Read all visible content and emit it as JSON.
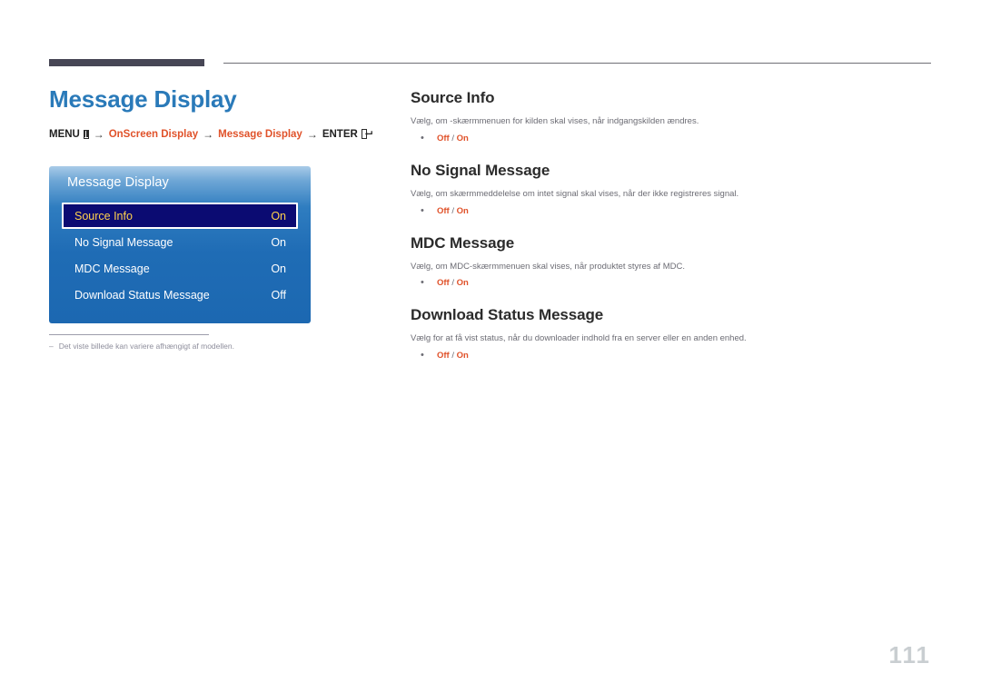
{
  "page": {
    "title": "Message Display",
    "number": "111"
  },
  "breadcrumb": {
    "menu_label": "MENU",
    "menu_icon": "menu-grid-icon",
    "arrow": "→",
    "step1": "OnScreen Display",
    "step2": "Message Display",
    "enter_label": "ENTER",
    "enter_icon": "enter-return-icon"
  },
  "osd_panel": {
    "title": "Message Display",
    "rows": [
      {
        "label": "Source Info",
        "value": "On",
        "selected": true
      },
      {
        "label": "No Signal Message",
        "value": "On",
        "selected": false
      },
      {
        "label": "MDC Message",
        "value": "On",
        "selected": false
      },
      {
        "label": "Download Status Message",
        "value": "Off",
        "selected": false
      }
    ]
  },
  "footnote": {
    "dash": "–",
    "text": "Det viste billede kan variere afhængigt af modellen."
  },
  "sections": [
    {
      "title": "Source Info",
      "desc": "Vælg, om -skærmmenuen for kilden skal vises, når indgangskilden ændres.",
      "bullet_dot": "•",
      "option_off": "Off",
      "option_sep": " / ",
      "option_on": "On"
    },
    {
      "title": "No Signal Message",
      "desc": "Vælg, om skærmmeddelelse om intet signal skal vises, når der ikke registreres signal.",
      "bullet_dot": "•",
      "option_off": "Off",
      "option_sep": " / ",
      "option_on": "On"
    },
    {
      "title": "MDC Message",
      "desc": "Vælg, om MDC-skærmmenuen skal vises, når produktet styres af MDC.",
      "bullet_dot": "•",
      "option_off": "Off",
      "option_sep": " / ",
      "option_on": "On"
    },
    {
      "title": "Download Status Message",
      "desc": "Vælg for at få vist status, når du downloader indhold fra en server eller en anden enhed.",
      "bullet_dot": "•",
      "option_off": "Off",
      "option_sep": " / ",
      "option_on": "On"
    }
  ],
  "colors": {
    "title_blue": "#2a7ab9",
    "accent_orange": "#e0522a",
    "panel_blue": "#1f6cb5",
    "selected_navy": "#0b0b72",
    "selected_gold": "#ffd24d",
    "rule_dark": "#474655",
    "page_number_gray": "#c9ced1"
  }
}
